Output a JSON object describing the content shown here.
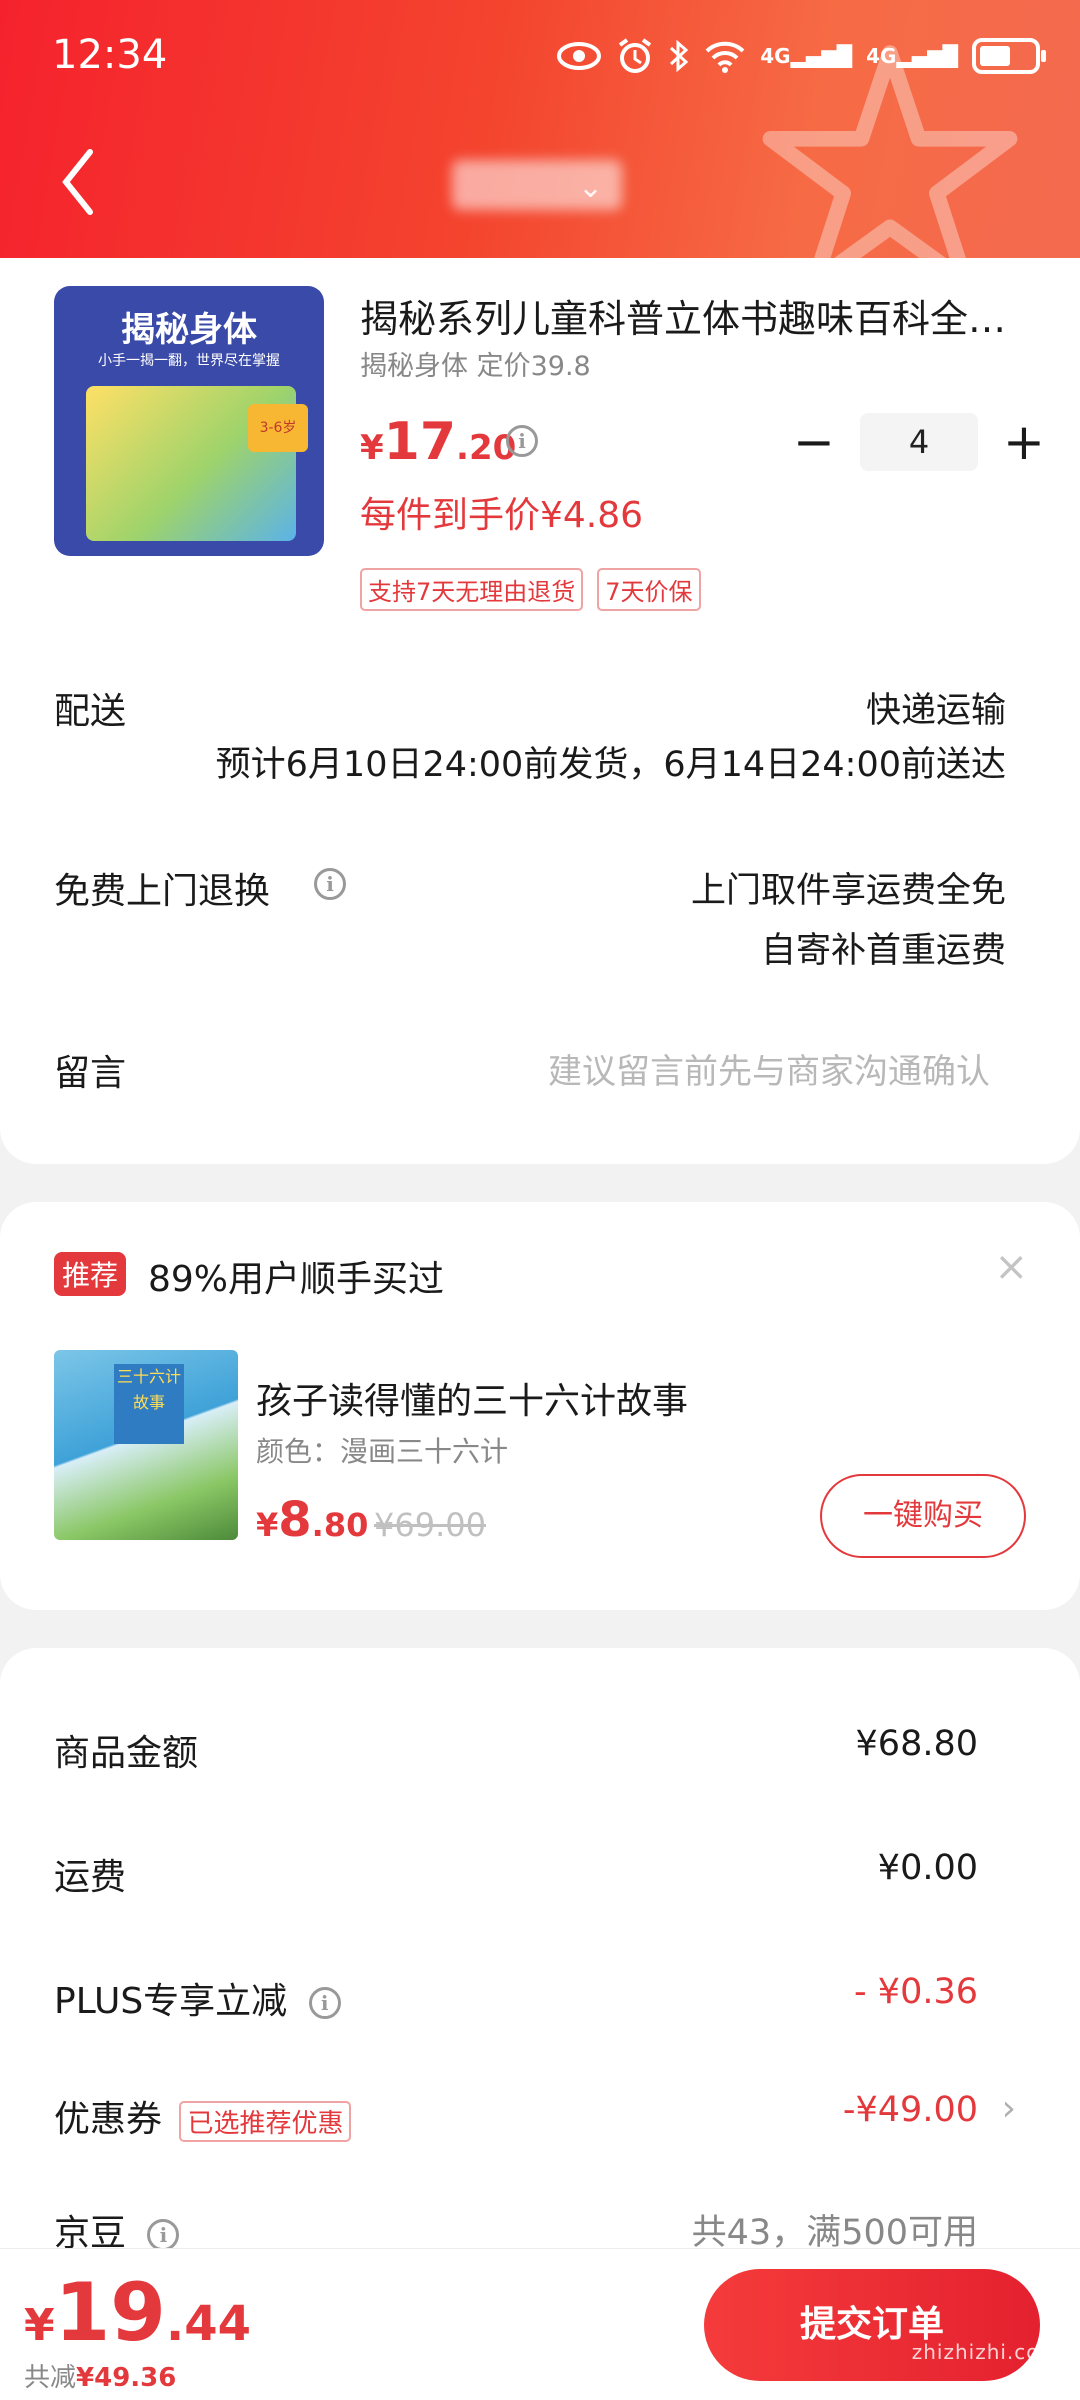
{
  "status_bar": {
    "time": "12:34",
    "icons": [
      "eye-icon",
      "alarm-icon",
      "bluetooth-icon",
      "wifi-icon",
      "signal-4g-icon",
      "signal-4g-icon",
      "battery-icon"
    ],
    "net1": "4G",
    "net2": "4G"
  },
  "header": {
    "back_icon": "chevron-left-icon",
    "title_dropdown_icon": "chevron-down-icon"
  },
  "product": {
    "title": "揭秘系列儿童科普立体书趣味百科全…",
    "spec": "揭秘身体 定价39.8",
    "price_currency": "¥",
    "price_int": "17",
    "price_dec": ".20",
    "quantity": "4",
    "minus": "−",
    "plus": "+",
    "unit_price": "每件到手价¥4.86",
    "tags": [
      "支持7天无理由退货",
      "7天价保"
    ],
    "image_title": "揭秘身体",
    "image_subtitle": "小手一揭一翻，世界尽在掌握",
    "image_badge": "3-6岁"
  },
  "delivery": {
    "label": "配送",
    "method": "快递运输",
    "estimate": "预计6月10日24:00前发货，6月14日24:00前送达"
  },
  "return_service": {
    "label": "免费上门退换",
    "line1": "上门取件享运费全免",
    "line2": "自寄补首重运费"
  },
  "message": {
    "label": "留言",
    "placeholder": "建议留言前先与商家沟通确认"
  },
  "recommend": {
    "badge": "推荐",
    "text": "89%用户顺手买过",
    "close": "×",
    "item_title": "孩子读得懂的三十六计故事",
    "item_spec": "颜色：漫画三十六计",
    "price_currency": "¥",
    "price_int": "8",
    "price_dec": ".80",
    "orig_price": "¥69.00",
    "buy_button": "一键购买",
    "image_title": "三十六计故事"
  },
  "summary": {
    "rows": [
      {
        "label": "商品金额",
        "value": "¥68.80"
      },
      {
        "label": "运费",
        "value": "¥0.00"
      },
      {
        "label": "PLUS专享立减",
        "value": "- ¥0.36"
      },
      {
        "label": "优惠券",
        "tag": "已选推荐优惠",
        "value": "-¥49.00"
      },
      {
        "label": "京豆",
        "value": "共43，满500可用"
      }
    ]
  },
  "bottom": {
    "total_currency": "¥",
    "total_int": "19",
    "total_dec": ".44",
    "saved_label": "共减",
    "saved_value": "¥49.36",
    "submit": "提交订单",
    "watermark": "zhizhizhi.com"
  },
  "colors": {
    "brand_red": "#e4393c",
    "header_gradient_start": "#f5222d",
    "header_gradient_end": "#f46a4f"
  }
}
